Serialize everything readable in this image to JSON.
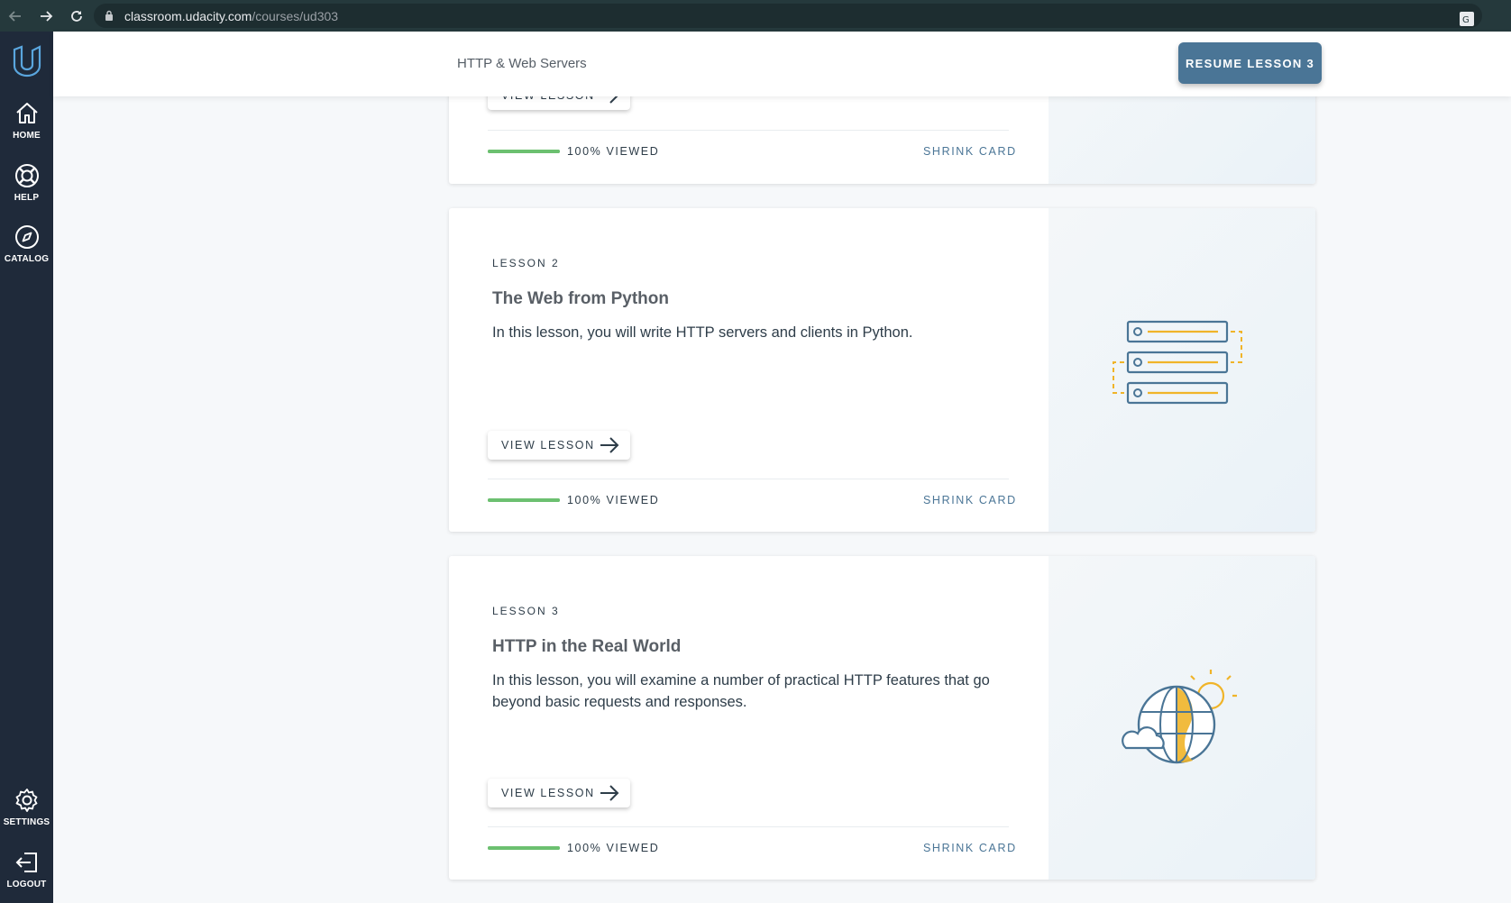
{
  "browser": {
    "url_host": "classroom.udacity.com",
    "url_path": "/courses/ud303"
  },
  "sidebar": {
    "items": [
      {
        "label": "HOME",
        "icon": "home-icon"
      },
      {
        "label": "HELP",
        "icon": "lifebuoy-icon"
      },
      {
        "label": "CATALOG",
        "icon": "compass-icon"
      },
      {
        "label": "SETTINGS",
        "icon": "gear-icon"
      },
      {
        "label": "LOGOUT",
        "icon": "logout-icon"
      }
    ]
  },
  "header": {
    "course_title": "HTTP & Web Servers",
    "resume_label": "RESUME LESSON 3"
  },
  "lessons": [
    {
      "view_label": "VIEW LESSON",
      "progress_percent": 100,
      "viewed_label": "100% VIEWED",
      "shrink_label": "SHRINK CARD"
    },
    {
      "number_label": "LESSON 2",
      "title": "The Web from Python",
      "description": "In this lesson, you will write HTTP servers and clients in Python.",
      "view_label": "VIEW LESSON",
      "progress_percent": 100,
      "viewed_label": "100% VIEWED",
      "shrink_label": "SHRINK CARD",
      "art_icon": "server-stack-icon"
    },
    {
      "number_label": "LESSON 3",
      "title": "HTTP in the Real World",
      "description": "In this lesson, you will examine a number of practical HTTP features that go beyond basic requests and responses.",
      "view_label": "VIEW LESSON",
      "progress_percent": 100,
      "viewed_label": "100% VIEWED",
      "shrink_label": "SHRINK CARD",
      "art_icon": "globe-sun-icon"
    }
  ],
  "colors": {
    "sidebar_bg": "#1f2a3a",
    "accent": "#4a7596",
    "progress": "#6cc070",
    "art_yellow": "#f0b429",
    "art_blue": "#4a7596"
  }
}
